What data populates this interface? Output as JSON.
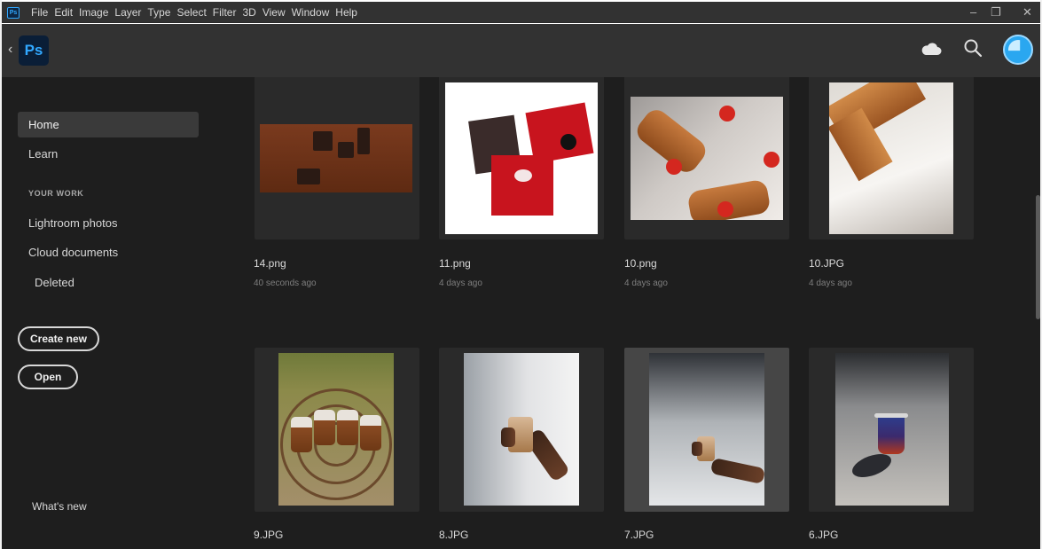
{
  "menubar": {
    "app_icon": "Ps",
    "items": [
      "File",
      "Edit",
      "Image",
      "Layer",
      "Type",
      "Select",
      "Filter",
      "3D",
      "View",
      "Window",
      "Help"
    ],
    "controls": [
      "minimize-icon",
      "restore-icon",
      "close-icon"
    ]
  },
  "header": {
    "back_icon": "chevron-left-icon",
    "logo_text": "Ps",
    "icons": [
      "cloud-icon",
      "search-icon",
      "avatar"
    ]
  },
  "sidebar": {
    "home": "Home",
    "learn": "Learn",
    "section_label": "YOUR WORK",
    "lightroom": "Lightroom photos",
    "cloud_docs": "Cloud documents",
    "deleted": "Deleted",
    "create_new": "Create new",
    "open": "Open",
    "whats_new": "What's new"
  },
  "files": [
    {
      "name": "14.png",
      "date": "40 seconds ago"
    },
    {
      "name": "11.png",
      "date": "4 days ago"
    },
    {
      "name": "10.png",
      "date": "4 days ago"
    },
    {
      "name": "10.JPG",
      "date": "4 days ago"
    },
    {
      "name": "9.JPG",
      "date": ""
    },
    {
      "name": "8.JPG",
      "date": ""
    },
    {
      "name": "7.JPG",
      "date": ""
    },
    {
      "name": "6.JPG",
      "date": ""
    }
  ],
  "colors": {
    "chrome": "#323232",
    "background": "#1e1e1e",
    "card": "#2a2a2a",
    "accent_blue": "#31a8ff"
  }
}
